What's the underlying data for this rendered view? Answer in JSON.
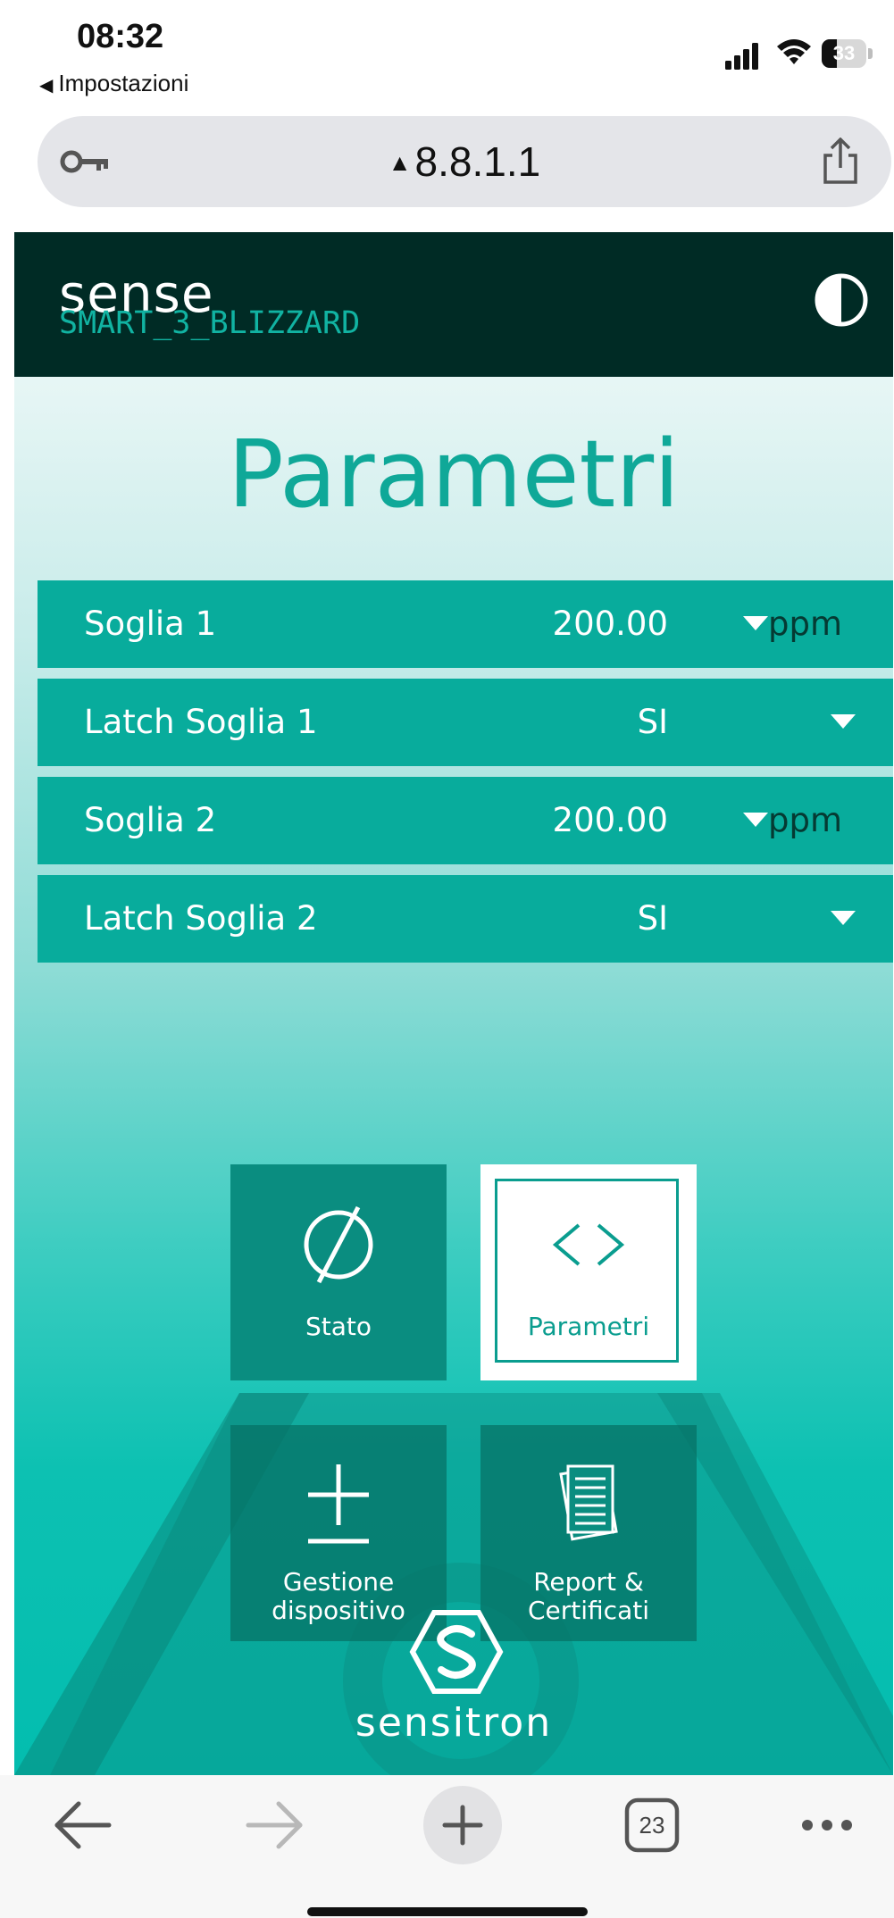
{
  "status_bar": {
    "time": "08:32",
    "back_app_label": "Impostazioni",
    "battery_percent": "33",
    "battery_level": 0.33
  },
  "browser": {
    "url": "8.8.1.1",
    "tab_count": "23",
    "icons": {
      "password": "key-icon",
      "insecure": "warning-icon",
      "share": "share-icon",
      "back": "arrow-left-icon",
      "forward": "arrow-right-icon",
      "new_tab": "plus-icon",
      "tabs": "tabs-icon",
      "more": "more-icon"
    }
  },
  "app": {
    "brand": "sense",
    "device_name": "SMART_3_BLIZZARD",
    "theme_toggle_icon": "contrast-icon",
    "colors": {
      "header_bg": "#002b25",
      "accent": "#0fa898",
      "row_bg": "#08ac9c",
      "tile_bg": "#0a8d80"
    }
  },
  "page": {
    "title": "Parametri",
    "parameters": [
      {
        "label": "Soglia 1",
        "value": "200.00",
        "unit": "ppm"
      },
      {
        "label": "Latch Soglia 1",
        "value": "SI",
        "unit": ""
      },
      {
        "label": "Soglia 2",
        "value": "200.00",
        "unit": "ppm"
      },
      {
        "label": "Latch Soglia 2",
        "value": "SI",
        "unit": ""
      }
    ]
  },
  "nav": {
    "tiles": [
      {
        "label": "Stato",
        "icon": "empty-set-icon",
        "active": false
      },
      {
        "label": "Parametri",
        "icon": "code-brackets-icon",
        "active": true
      },
      {
        "label_line1": "Gestione",
        "label_line2": "dispositivo",
        "icon": "plus-minus-icon",
        "active": false
      },
      {
        "label_line1": "Report &",
        "label_line2": "Certificati",
        "icon": "documents-icon",
        "active": false
      }
    ]
  },
  "footer": {
    "logo_text": "sensitron",
    "logo_icon": "sensitron-logo-icon"
  }
}
